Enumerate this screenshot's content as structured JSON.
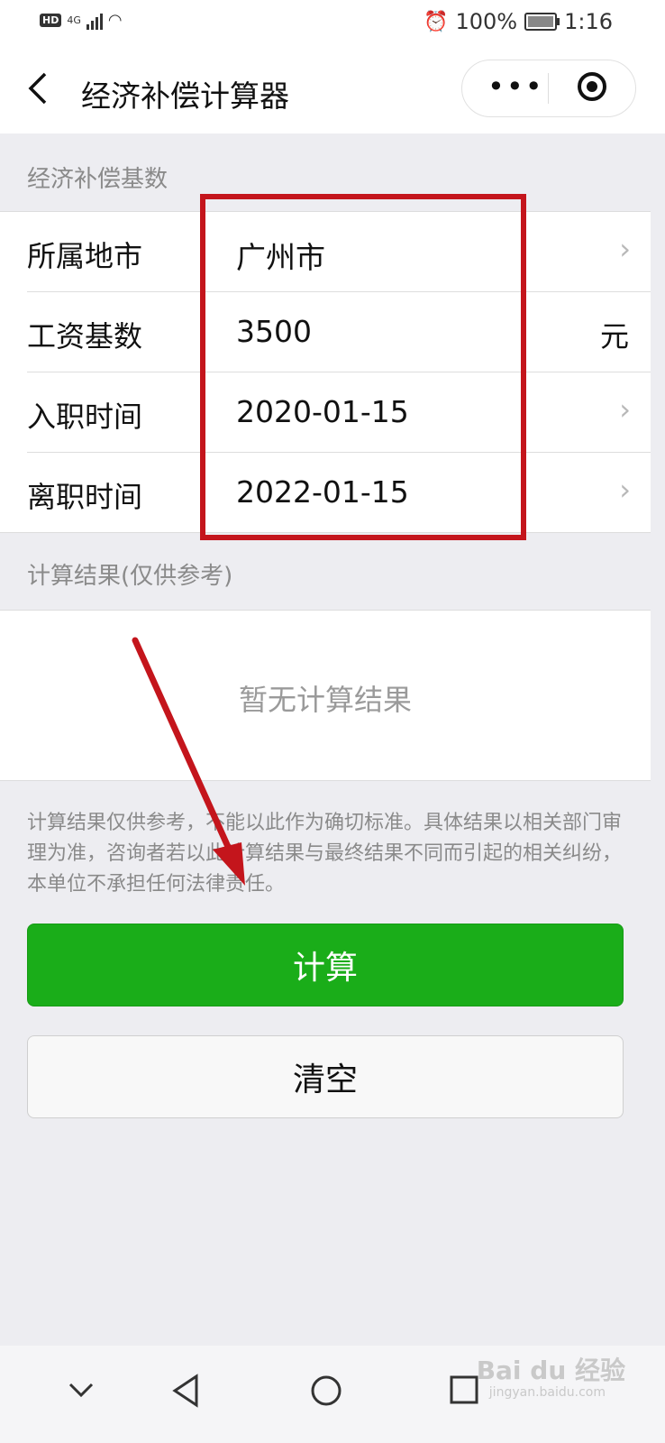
{
  "status_bar": {
    "network": "HD",
    "signal": "4G",
    "battery": "100%",
    "time": "1:16",
    "icons": [
      "alarm-icon",
      "wifi-icon",
      "battery-icon"
    ]
  },
  "nav": {
    "title": "经济补偿计算器",
    "back_icon": "chevron-left-icon",
    "more_icon": "more-dots-icon",
    "close_icon": "record-icon"
  },
  "section_base": "经济补偿基数",
  "form": [
    {
      "label": "所属地市",
      "value": "广州市",
      "suffix": "chevron"
    },
    {
      "label": "工资基数",
      "value": "3500",
      "suffix": "元"
    },
    {
      "label": "入职时间",
      "value": "2020-01-15",
      "suffix": "chevron"
    },
    {
      "label": "离职时间",
      "value": "2022-01-15",
      "suffix": "chevron"
    }
  ],
  "section_result": "计算结果(仅供参考)",
  "result_empty": "暂无计算结果",
  "disclaimer": "计算结果仅供参考，不能以此作为确切标准。具体结果以相关部门审理为准，咨询者若以此计算结果与最终结果不同而引起的相关纠纷，本单位不承担任何法律责任。",
  "buttons": {
    "calculate": "计算",
    "clear": "清空"
  },
  "watermark": {
    "brand": "Bai du 经验",
    "url": "jingyan.baidu.com"
  },
  "colors": {
    "primary": "#1aad19",
    "highlight": "#c4151c",
    "background": "#ededf1"
  }
}
